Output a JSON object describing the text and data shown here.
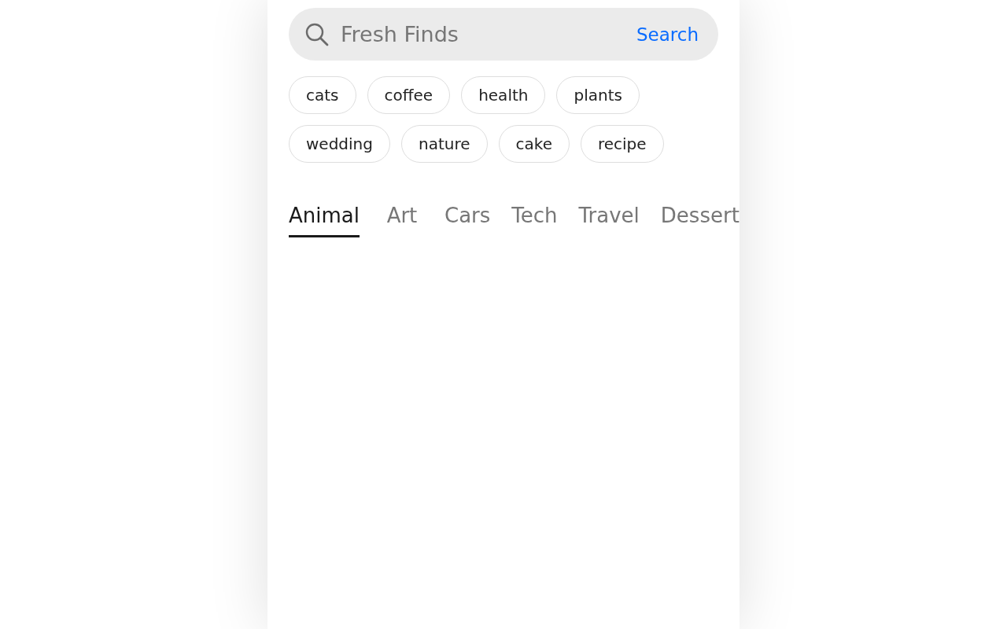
{
  "search": {
    "placeholder": "Fresh Finds",
    "button": "Search"
  },
  "chips": [
    {
      "label": "cats"
    },
    {
      "label": "coffee"
    },
    {
      "label": "health"
    },
    {
      "label": "plants"
    },
    {
      "label": "wedding"
    },
    {
      "label": "nature"
    },
    {
      "label": "cake"
    },
    {
      "label": "recipe"
    }
  ],
  "tabs": [
    {
      "label": "Animal",
      "selected": true
    },
    {
      "label": "Art",
      "selected": false
    },
    {
      "label": "Cars",
      "selected": false
    },
    {
      "label": "Tech",
      "selected": false
    },
    {
      "label": "Travel",
      "selected": false
    },
    {
      "label": "Dessert",
      "selected": false
    }
  ]
}
